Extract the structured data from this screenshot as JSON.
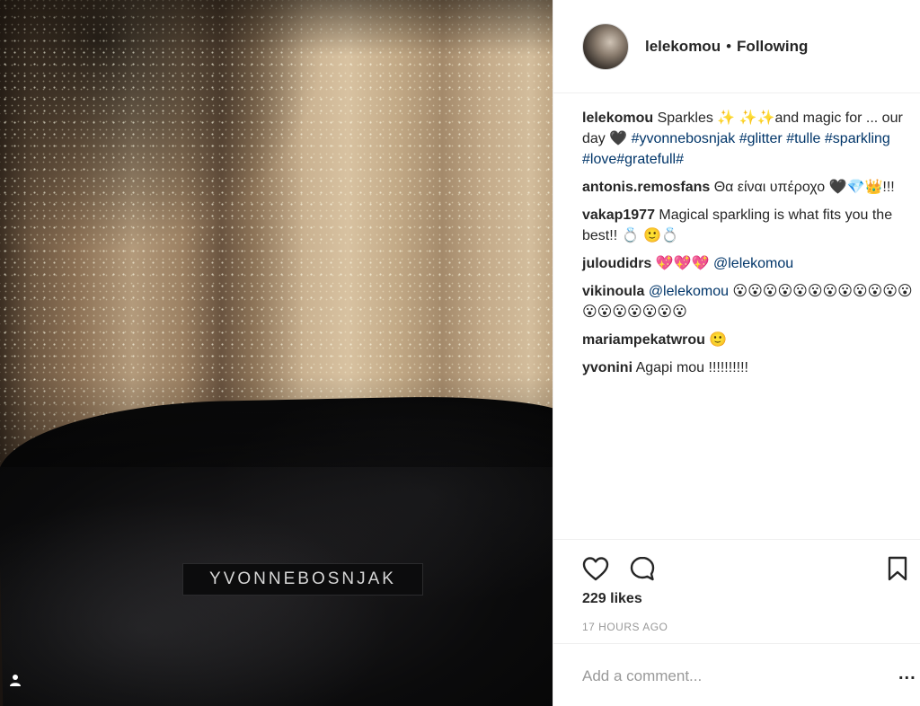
{
  "photo": {
    "label_text": "YVONNEBOSNJAK",
    "tag_icon": "person-tag-icon"
  },
  "header": {
    "username": "lelekomou",
    "separator": "•",
    "follow_status": "Following"
  },
  "caption": {
    "user": "lelekomou",
    "text": "Sparkles ✨ ✨✨and magic for ... our day 🖤 ",
    "tags": [
      "#yvonnebosnjak",
      "#glitter",
      "#tulle",
      "#sparkling",
      "#love",
      "#gratefull",
      "#"
    ]
  },
  "comments": [
    {
      "user": "antonis.remosfans",
      "text": "Θα είναι υπέροχο 🖤💎👑!!!"
    },
    {
      "user": "vakap1977",
      "text": "Magical sparkling is what fits you the best!! 💍 🙂💍"
    },
    {
      "user": "juloudidrs",
      "text": "💖💖💖 ",
      "mention": "@lelekomou"
    },
    {
      "user": "vikinoula",
      "mention": "@lelekomou",
      "text": " 😮😮😮😮😮😮😮😮😮😮😮😮😮😮😮😮😮😮😮"
    },
    {
      "user": "mariampekatwrou",
      "text": "🙂"
    },
    {
      "user": "yvonini",
      "text": "Agapi mou !!!!!!!!!!"
    }
  ],
  "actions": {
    "like_icon": "heart-icon",
    "comment_icon": "comment-bubble-icon",
    "save_icon": "bookmark-icon",
    "likes": "229 likes",
    "time": "17 HOURS AGO",
    "comment_placeholder": "Add a comment...",
    "more_label": "..."
  }
}
